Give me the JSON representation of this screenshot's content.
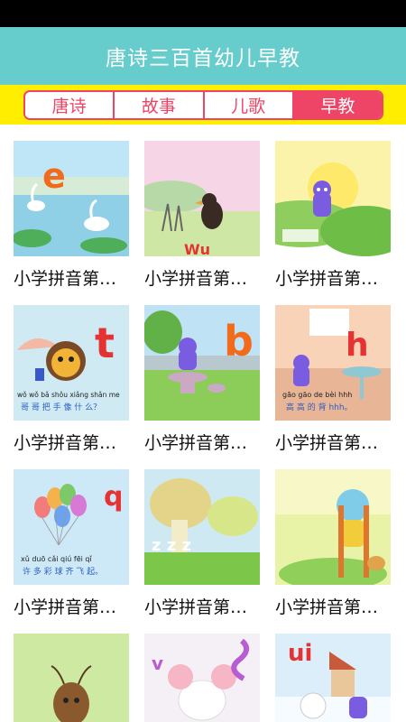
{
  "app": {
    "title": "唐诗三百首幼儿早教"
  },
  "tabs": [
    {
      "label": "唐诗",
      "active": false
    },
    {
      "label": "故事",
      "active": false
    },
    {
      "label": "儿歌",
      "active": false
    },
    {
      "label": "早教",
      "active": true
    }
  ],
  "colors": {
    "header": "#66cccc",
    "tabstrip": "#ffee00",
    "accent": "#ee4466"
  },
  "videos": [
    {
      "title": "小学拼音第…",
      "letter": "e",
      "scene": "lake-swans"
    },
    {
      "title": "小学拼音第…",
      "letter": "Wu",
      "scene": "crow-field"
    },
    {
      "title": "小学拼音第…",
      "letter": "",
      "scene": "cat-sunrise"
    },
    {
      "title": "小学拼音第…",
      "letter": "t",
      "scene": "bird-umbrella",
      "pinyin": "wǒ wǒ bǎ shǒu xiǎng shǎn me",
      "hanzi": "哥 哥 把 手 像 什 么？"
    },
    {
      "title": "小学拼音第…",
      "letter": "b",
      "scene": "cat-park"
    },
    {
      "title": "小学拼音第…",
      "letter": "h",
      "scene": "cat-room",
      "pinyin": "gāo gāo de bèi hhh",
      "hanzi": "高 高 的 背 hhh。"
    },
    {
      "title": "小学拼音第…",
      "letter": "q",
      "scene": "balloons",
      "pinyin": "xǔ duō cǎi qiú fēi qǐ",
      "hanzi": "许 多 彩 球 齐 飞 起。"
    },
    {
      "title": "小学拼音第…",
      "letter": "z z z",
      "scene": "mushrooms"
    },
    {
      "title": "小学拼音第…",
      "letter": "",
      "scene": "rabbit-stilts"
    },
    {
      "title": "",
      "letter": "",
      "scene": "ant-grass"
    },
    {
      "title": "",
      "letter": "v",
      "scene": "mouse-letters"
    },
    {
      "title": "",
      "letter": "ui",
      "scene": "snow-village"
    }
  ]
}
